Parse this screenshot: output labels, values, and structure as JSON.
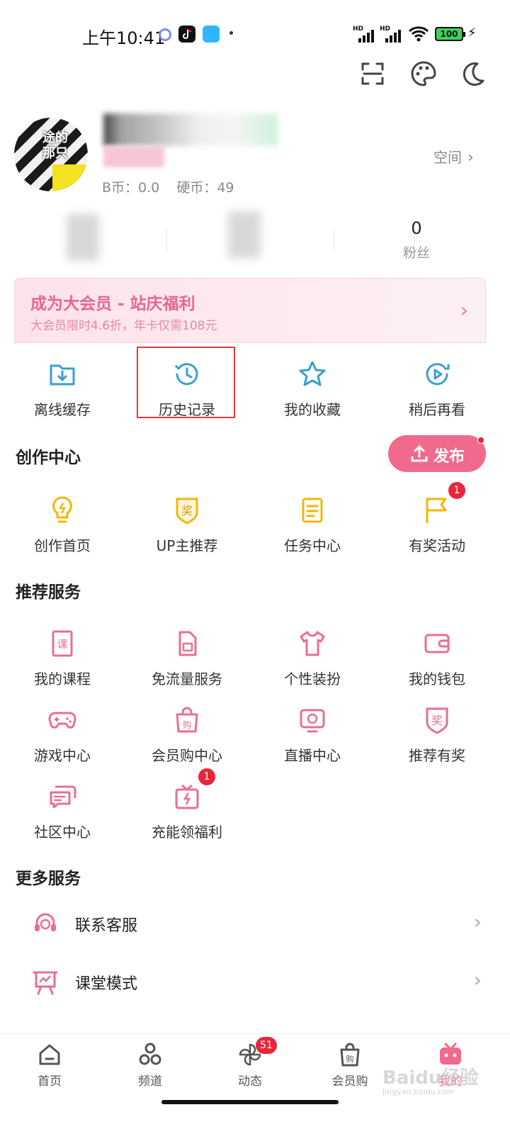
{
  "status_bar": {
    "time": "上午10:41",
    "battery": "100",
    "signal_label": "HD"
  },
  "profile": {
    "avatar_text": "途的 那只",
    "b_coins": "B币：0.0",
    "coins": "硬币：49",
    "space_label": "空间",
    "stats": [
      {
        "num": "",
        "label": ""
      },
      {
        "num": "",
        "label": ""
      },
      {
        "num": "0",
        "label": "粉丝"
      }
    ]
  },
  "vip": {
    "title": "成为大会员 - 站庆福利",
    "subtitle": "大会员限时4.6折，年卡仅需108元"
  },
  "quick": [
    {
      "label": "离线缓存",
      "icon": "download-folder-icon"
    },
    {
      "label": "历史记录",
      "icon": "history-clock-icon"
    },
    {
      "label": "我的收藏",
      "icon": "star-icon"
    },
    {
      "label": "稍后再看",
      "icon": "watch-later-icon"
    }
  ],
  "creation": {
    "title": "创作中心",
    "publish_label": "发布",
    "items": [
      {
        "label": "创作首页",
        "icon": "lightbulb-icon"
      },
      {
        "label": "UP主推荐",
        "icon": "award-badge-icon"
      },
      {
        "label": "任务中心",
        "icon": "task-clipboard-icon"
      },
      {
        "label": "有奖活动",
        "icon": "flag-icon",
        "badge": "1"
      }
    ]
  },
  "services": {
    "title": "推荐服务",
    "items": [
      {
        "label": "我的课程",
        "icon": "course-book-icon"
      },
      {
        "label": "免流量服务",
        "icon": "sim-card-icon"
      },
      {
        "label": "个性装扮",
        "icon": "tshirt-icon"
      },
      {
        "label": "我的钱包",
        "icon": "wallet-icon"
      },
      {
        "label": "游戏中心",
        "icon": "gamepad-icon"
      },
      {
        "label": "会员购中心",
        "icon": "shopping-bag-icon"
      },
      {
        "label": "直播中心",
        "icon": "live-tv-icon"
      },
      {
        "label": "推荐有奖",
        "icon": "reward-badge-icon"
      },
      {
        "label": "社区中心",
        "icon": "chat-bubbles-icon"
      },
      {
        "label": "充能领福利",
        "icon": "gift-bolt-icon",
        "badge": "1"
      }
    ]
  },
  "more": {
    "title": "更多服务",
    "items": [
      {
        "label": "联系客服",
        "icon": "headset-icon"
      },
      {
        "label": "课堂模式",
        "icon": "classroom-board-icon"
      }
    ]
  },
  "bottom_nav": [
    {
      "label": "首页",
      "icon": "home-icon"
    },
    {
      "label": "频道",
      "icon": "channel-icon"
    },
    {
      "label": "动态",
      "icon": "pinwheel-icon",
      "badge": "51"
    },
    {
      "label": "会员购",
      "icon": "shopping-bag-icon"
    },
    {
      "label": "我的",
      "icon": "tv-mascot-icon"
    }
  ],
  "watermark": {
    "text": "Baidu经验",
    "sub": "jingyan.baidu.com"
  },
  "colors": {
    "accent": "#f06a8d",
    "blue": "#3a9fd0",
    "yellow": "#f2b705",
    "badge": "#e8263b"
  }
}
